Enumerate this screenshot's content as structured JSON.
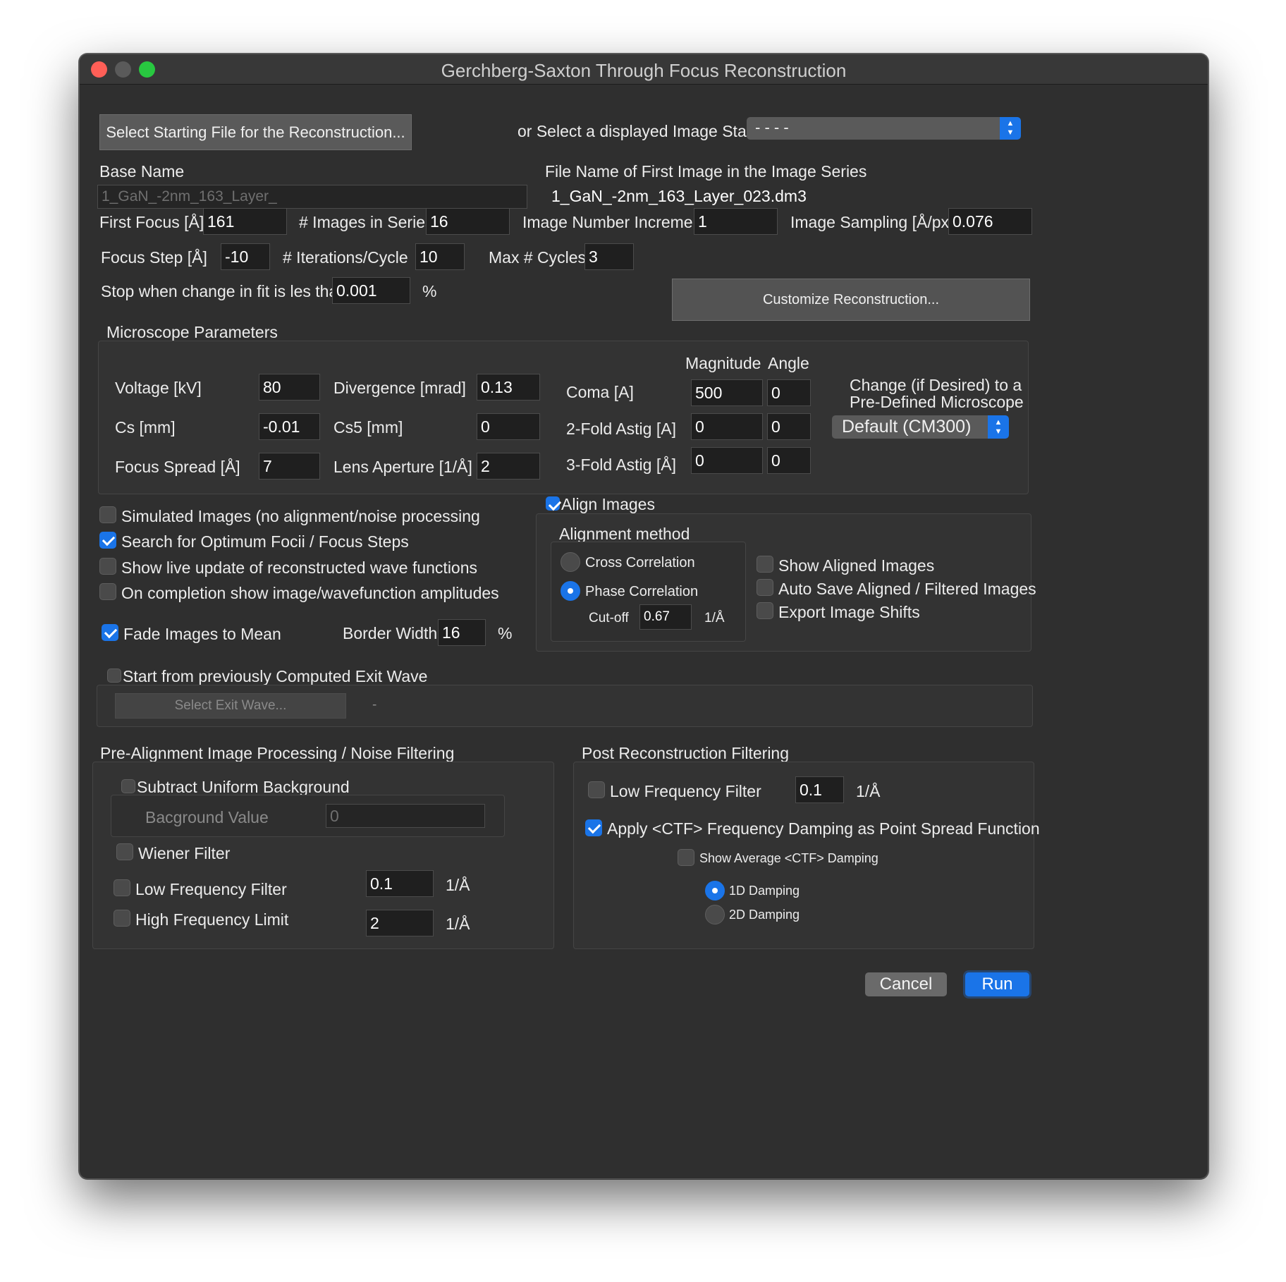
{
  "window": {
    "title": "Gerchberg-Saxton Through Focus Reconstruction"
  },
  "top": {
    "select_file_button": "Select Starting File for the Reconstruction...",
    "or_select_stack_label": "or Select a displayed Image Stack",
    "stack_value": "- - - -"
  },
  "names": {
    "base_name_label": "Base Name",
    "base_name_value": "1_GaN_-2nm_163_Layer_",
    "first_file_label": "File Name of First Image in the Image Series",
    "first_file_value": "1_GaN_-2nm_163_Layer_023.dm3"
  },
  "series": {
    "first_focus_label": "First Focus [Å]",
    "first_focus_value": "161",
    "images_in_series_label": "# Images in Series",
    "images_in_series_value": "16",
    "image_number_increment_label": "Image Number Increment",
    "image_number_increment_value": "1",
    "image_sampling_label": "Image Sampling [Å/px]",
    "image_sampling_value": "0.076",
    "focus_step_label": "Focus Step [Å]",
    "focus_step_value": "-10",
    "iterations_label": "# Iterations/Cycle",
    "iterations_value": "10",
    "max_cycles_label": "Max # Cycles",
    "max_cycles_value": "3",
    "stop_label": "Stop when change in fit is les than",
    "stop_value": "0.001",
    "stop_unit": "%",
    "customize_button": "Customize Reconstruction..."
  },
  "microscope": {
    "group_label": "Microscope Parameters",
    "voltage_label": "Voltage [kV]",
    "voltage_value": "80",
    "cs_label": "Cs [mm]",
    "cs_value": "-0.01",
    "focus_spread_label": "Focus Spread [Å]",
    "focus_spread_value": "7",
    "divergence_label": "Divergence [mrad]",
    "divergence_value": "0.13",
    "cs5_label": "Cs5 [mm]",
    "cs5_value": "0",
    "lens_aperture_label": "Lens Aperture [1/Å]",
    "lens_aperture_value": "2",
    "magnitude_header": "Magnitude",
    "angle_header": "Angle",
    "coma_label": "Coma [A]",
    "coma_magnitude": "500",
    "coma_angle": "0",
    "astig2_label": "2-Fold Astig [A]",
    "astig2_magnitude": "0",
    "astig2_angle": "0",
    "astig3_label": "3-Fold Astig [Å]",
    "astig3_magnitude": "0",
    "astig3_angle": "0",
    "predefined_label_1": "Change (if Desired) to a",
    "predefined_label_2": "Pre-Defined Microscope",
    "predefined_value": "Default (CM300)"
  },
  "options": {
    "simulated_label": "Simulated Images (no alignment/noise processing",
    "simulated_checked": false,
    "search_focii_label": "Search for Optimum Focii / Focus Steps",
    "search_focii_checked": true,
    "live_update_label": "Show live update of reconstructed wave functions",
    "live_update_checked": false,
    "on_completion_label": "On completion show image/wavefunction amplitudes",
    "on_completion_checked": false,
    "fade_label": "Fade Images to Mean",
    "fade_checked": true,
    "border_width_label": "Border Width",
    "border_width_value": "16",
    "border_width_unit": "%"
  },
  "alignment": {
    "align_images_label": "Align Images",
    "align_images_checked": true,
    "method_label": "Alignment method",
    "cross_correlation_label": "Cross Correlation",
    "phase_correlation_label": "Phase Correlation",
    "selected_method": "Phase Correlation",
    "cutoff_label": "Cut-off",
    "cutoff_value": "0.67",
    "cutoff_unit": "1/Å",
    "show_aligned_label": "Show Aligned Images",
    "auto_save_label": "Auto Save Aligned / Filtered Images",
    "export_shifts_label": "Export Image Shifts"
  },
  "exit_wave": {
    "start_from_label": "Start from previously Computed Exit Wave",
    "start_from_checked": false,
    "select_button": "Select Exit Wave...",
    "selected_value": "-"
  },
  "pre_alignment": {
    "group_label": "Pre-Alignment Image Processing / Noise Filtering",
    "subtract_background_label": "Subtract Uniform Background",
    "background_value_label": "Bacground Value",
    "background_value": "0",
    "wiener_label": "Wiener Filter",
    "low_freq_label": "Low Frequency Filter",
    "low_freq_value": "0.1",
    "low_freq_unit": "1/Å",
    "high_freq_label": "High Frequency Limit",
    "high_freq_value": "2",
    "high_freq_unit": "1/Å"
  },
  "post_recon": {
    "group_label": "Post Reconstruction Filtering",
    "low_freq_label": "Low Frequency Filter",
    "low_freq_value": "0.1",
    "low_freq_unit": "1/Å",
    "ctf_damping_label": "Apply <CTF> Frequency Damping as Point Spread Function",
    "ctf_damping_checked": true,
    "show_avg_label": "Show Average  <CTF>  Damping",
    "damping_1d_label": "1D Damping",
    "damping_2d_label": "2D Damping",
    "selected_damping": "1D Damping"
  },
  "footer": {
    "cancel_button": "Cancel",
    "run_button": "Run"
  },
  "colors": {
    "accent": "#1a74e8",
    "window_bg": "#2f2f2f",
    "field_bg": "#1f1f1f",
    "close": "#ff5f57",
    "minimize": "#5a5a5a",
    "zoom": "#28c840"
  }
}
